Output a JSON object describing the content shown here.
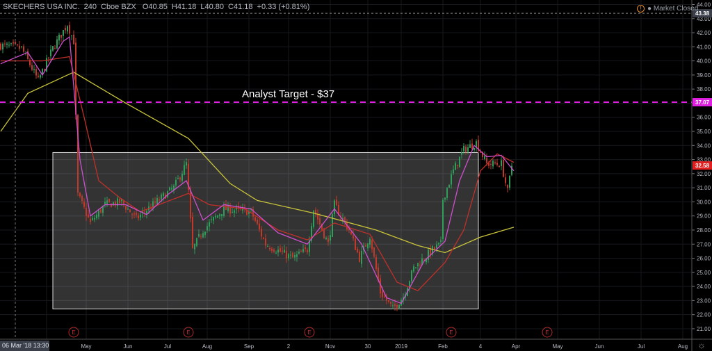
{
  "header": {
    "symbol": "SKECHERS USA INC.",
    "interval": "240",
    "exchange": "Cboe BZX",
    "open": "O40.85",
    "high": "H41.18",
    "low": "L40.80",
    "close": "C41.18",
    "change": "+0.33 (+0.81%)"
  },
  "status": {
    "market": "Market Closed"
  },
  "annotation": {
    "target_label": "Analyst Target - $37"
  },
  "crosshair": {
    "date_label": "06 Mar '18   13:30"
  },
  "colors": {
    "up": "#2e9e5a",
    "down": "#c0392b",
    "ma_fast": "#d04fd0",
    "ma_mid": "#c0302a",
    "ma_slow": "#c9c43a",
    "target": "#e020e0",
    "last": "#e02020"
  },
  "chart_data": {
    "type": "candlestick",
    "title": "SKECHERS USA INC., 240, Cboe BZX",
    "ylim": [
      20.5,
      44.3
    ],
    "y_ticks": [
      21,
      22,
      23,
      24,
      25,
      26,
      27,
      28,
      29,
      30,
      31,
      32,
      33,
      34,
      35,
      36,
      37,
      38,
      39,
      40,
      41,
      42,
      43,
      44
    ],
    "x_ticks": [
      {
        "bar": 22,
        "label": "pr"
      },
      {
        "bar": 41,
        "label": "May"
      },
      {
        "bar": 61,
        "label": "Jun"
      },
      {
        "bar": 80,
        "label": "Jul"
      },
      {
        "bar": 99,
        "label": "Aug"
      },
      {
        "bar": 119,
        "label": "Sep"
      },
      {
        "bar": 138,
        "label": "2"
      },
      {
        "bar": 158,
        "label": "Nov"
      },
      {
        "bar": 176,
        "label": "30"
      },
      {
        "bar": 192,
        "label": "2019"
      },
      {
        "bar": 212,
        "label": "Feb"
      },
      {
        "bar": 230,
        "label": "4"
      },
      {
        "bar": 247,
        "label": "Apr"
      },
      {
        "bar": 267,
        "label": "May"
      },
      {
        "bar": 287,
        "label": "Jun"
      },
      {
        "bar": 307,
        "label": "Jul"
      },
      {
        "bar": 327,
        "label": "Aug"
      }
    ],
    "price_path": [
      [
        0,
        41.1
      ],
      [
        10,
        40.9
      ],
      [
        18,
        38.6
      ],
      [
        25,
        40.9
      ],
      [
        32,
        42.6
      ],
      [
        35,
        41.4
      ],
      [
        37,
        30.5
      ],
      [
        43,
        28.5
      ],
      [
        50,
        29.8
      ],
      [
        58,
        30
      ],
      [
        65,
        28.8
      ],
      [
        73,
        29.8
      ],
      [
        83,
        31
      ],
      [
        89,
        32.7
      ],
      [
        92,
        26.6
      ],
      [
        97,
        28
      ],
      [
        107,
        29.5
      ],
      [
        120,
        29.3
      ],
      [
        127,
        27
      ],
      [
        140,
        26
      ],
      [
        147,
        26.6
      ],
      [
        150,
        29.5
      ],
      [
        157,
        27
      ],
      [
        160,
        29.8
      ],
      [
        167,
        28
      ],
      [
        172,
        26
      ],
      [
        177,
        27.6
      ],
      [
        182,
        23.6
      ],
      [
        188,
        22.4
      ],
      [
        193,
        23.3
      ],
      [
        198,
        25.3
      ],
      [
        207,
        26.6
      ],
      [
        211,
        27
      ],
      [
        212,
        30.2
      ],
      [
        217,
        32.2
      ],
      [
        222,
        33.7
      ],
      [
        228,
        34.2
      ],
      [
        233,
        32.7
      ],
      [
        240,
        32.7
      ],
      [
        243,
        30.7
      ],
      [
        245,
        32.58
      ]
    ],
    "moving_averages": [
      {
        "name": "MA slow",
        "color": "#c9c43a",
        "points": [
          [
            0,
            35.0
          ],
          [
            13,
            37.7
          ],
          [
            35,
            39.2
          ],
          [
            60,
            37.0
          ],
          [
            90,
            34.5
          ],
          [
            110,
            31.3
          ],
          [
            123,
            30.1
          ],
          [
            150,
            29.2
          ],
          [
            180,
            28.0
          ],
          [
            200,
            26.9
          ],
          [
            213,
            26.4
          ],
          [
            230,
            27.5
          ],
          [
            246,
            28.2
          ]
        ]
      },
      {
        "name": "MA mid",
        "color": "#c0302a",
        "points": [
          [
            0,
            40.0
          ],
          [
            20,
            40.0
          ],
          [
            33,
            40.3
          ],
          [
            40,
            36
          ],
          [
            47,
            31.5
          ],
          [
            57,
            30.3
          ],
          [
            67,
            29.3
          ],
          [
            90,
            30.6
          ],
          [
            100,
            29.8
          ],
          [
            117,
            29.5
          ],
          [
            133,
            28.0
          ],
          [
            147,
            27.3
          ],
          [
            160,
            28.5
          ],
          [
            177,
            27.7
          ],
          [
            190,
            24.3
          ],
          [
            200,
            23.7
          ],
          [
            213,
            25.7
          ],
          [
            222,
            28
          ],
          [
            230,
            32.2
          ],
          [
            238,
            33.4
          ],
          [
            246,
            32.8
          ]
        ]
      },
      {
        "name": "MA fast",
        "color": "#d04fd0",
        "points": [
          [
            0,
            39.8
          ],
          [
            13,
            40.6
          ],
          [
            20,
            39.0
          ],
          [
            30,
            41.4
          ],
          [
            33,
            41.7
          ],
          [
            38,
            33
          ],
          [
            43,
            29
          ],
          [
            50,
            29.8
          ],
          [
            60,
            29.8
          ],
          [
            70,
            29.1
          ],
          [
            80,
            30.5
          ],
          [
            89,
            31.5
          ],
          [
            97,
            28.7
          ],
          [
            107,
            29.8
          ],
          [
            120,
            29.5
          ],
          [
            133,
            27.8
          ],
          [
            147,
            27.0
          ],
          [
            160,
            29.5
          ],
          [
            173,
            27
          ],
          [
            185,
            23.2
          ],
          [
            192,
            22.8
          ],
          [
            203,
            25.8
          ],
          [
            213,
            27.2
          ],
          [
            220,
            31.5
          ],
          [
            227,
            34
          ],
          [
            233,
            33.2
          ],
          [
            240,
            33.3
          ],
          [
            246,
            32.2
          ]
        ]
      }
    ],
    "range_box": {
      "start_bar": 25,
      "end_bar": 229,
      "top": 33.5,
      "bottom": 22.4
    },
    "horizontal_line": {
      "price": 37.07,
      "label": "37.07"
    },
    "price_labels": {
      "high": "43.38",
      "target": "37.07",
      "last": "32.58"
    },
    "earnings_markers": {
      "label": "E",
      "bars": [
        35,
        90,
        148,
        216,
        262
      ]
    }
  }
}
